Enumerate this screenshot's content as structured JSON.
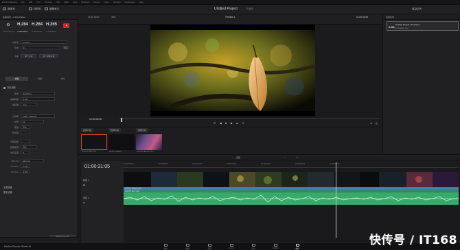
{
  "menubar": {
    "items": [
      "DaVinci Resolve",
      "File",
      "Edit",
      "Trim",
      "Timeline",
      "Clip",
      "Mark",
      "View",
      "Playback",
      "Fusion",
      "Color",
      "Fairlight",
      "Workspace",
      "Help"
    ]
  },
  "toolbar": {
    "media_pool": "媒体池",
    "effects": "特效库",
    "edit_index": "编辑索引",
    "project_title": "Untitled Project",
    "project_state": "已编辑",
    "timeline_name": "Timeline 1",
    "render_queue": "渲染队列"
  },
  "left_panel": {
    "header": "渲染设置 - H.264 Master",
    "presets": [
      {
        "big": "⚙",
        "caption": "Custom Export"
      },
      {
        "big": "H.264",
        "caption": "H.264 Master"
      },
      {
        "big": "H.264",
        "caption": "H.265 Master"
      },
      {
        "big": "H.265",
        "caption": "H.265 Master"
      }
    ],
    "filename_label": "文件名",
    "filename_value": "Timeline",
    "location_label": "位置",
    "location_value": "D:\\...",
    "browse_button": "浏览",
    "render_label": "渲染",
    "single_clip": "单个片段",
    "individual_clips": "多个单独片段",
    "tabs": [
      "视频",
      "音频",
      "文件"
    ],
    "export_video": "导出视频",
    "format_label": "格式",
    "format_value": "QuickTime",
    "codec_label": "编解码器",
    "codec_value": "H.264",
    "encoder_label": "编码器",
    "encoder_value": "Auto",
    "resolution_label": "分辨率",
    "resolution_value": "1920 x 1080 HD",
    "framerate_label": "帧率",
    "framerate_value": "24",
    "quality_label": "质量",
    "quality_value": "自动",
    "field_rendering": "场渲染",
    "advanced_label": "高级设置",
    "data_levels": "数据级别",
    "data_levels_value": "自动",
    "bit_depth": "比特深度",
    "bit_depth_value": "8",
    "audio_ch1": "Timeline",
    "audio_ch1_value": "H.264",
    "audio_ch2": "Timeline",
    "audio_ch2_value": "H.264",
    "gamma_label": "Gamma",
    "gamma_value": "Same as",
    "subtitle_settings": "字幕设置",
    "more_settings": "更多设置",
    "add_to_queue": "添加到渲染队列"
  },
  "viewer": {
    "source_tc": "01:00:00:00",
    "zoom": "38%",
    "clip_name": "Timeline 1",
    "record_tc": "01:00:31:05",
    "in_out": "01:00:00:00",
    "duration": "00:00:31:05"
  },
  "queue": {
    "title": "渲染队列",
    "job_title": "Untitled Project | Timeline 1",
    "job_codec": "H.264",
    "job_detail": "D:\\Timeline.mov"
  },
  "bins": {
    "tabs": [
      "视频片段",
      "视频片段",
      "视频片段"
    ],
    "thumbs": [
      {
        "caption": "OUTIST PAINT 4.1",
        "color": "#1a1a1a"
      },
      {
        "caption": "OUTIST SAGA 2",
        "color": "#0f0f12"
      },
      {
        "caption": "OUTIST RECAP 4.1.2",
        "color": "#3a2a4d"
      }
    ]
  },
  "timeline": {
    "tc": "01:00:31:05",
    "ticks": [
      "01:00:00:00",
      "01:00:05:00",
      "01:00:10:00",
      "01:00:15:00",
      "01:00:20:00",
      "01:00:25:00",
      "01:00:30:00"
    ],
    "v1_label": "视频 1",
    "v1_clip": "OUTIST SAGA 4.mp4",
    "a1_label": "音频 1",
    "a1_clip": "OUTIST 2017.mp4",
    "zoom_label": "适配"
  },
  "pagenav": {
    "brand": "DaVinci Resolve Studio 16",
    "pages": [
      "媒体",
      "快编",
      "剪辑",
      "Fusion",
      "调色",
      "Fairlight",
      "交付"
    ],
    "active": 6
  },
  "watermark": "快传号 / IT168"
}
